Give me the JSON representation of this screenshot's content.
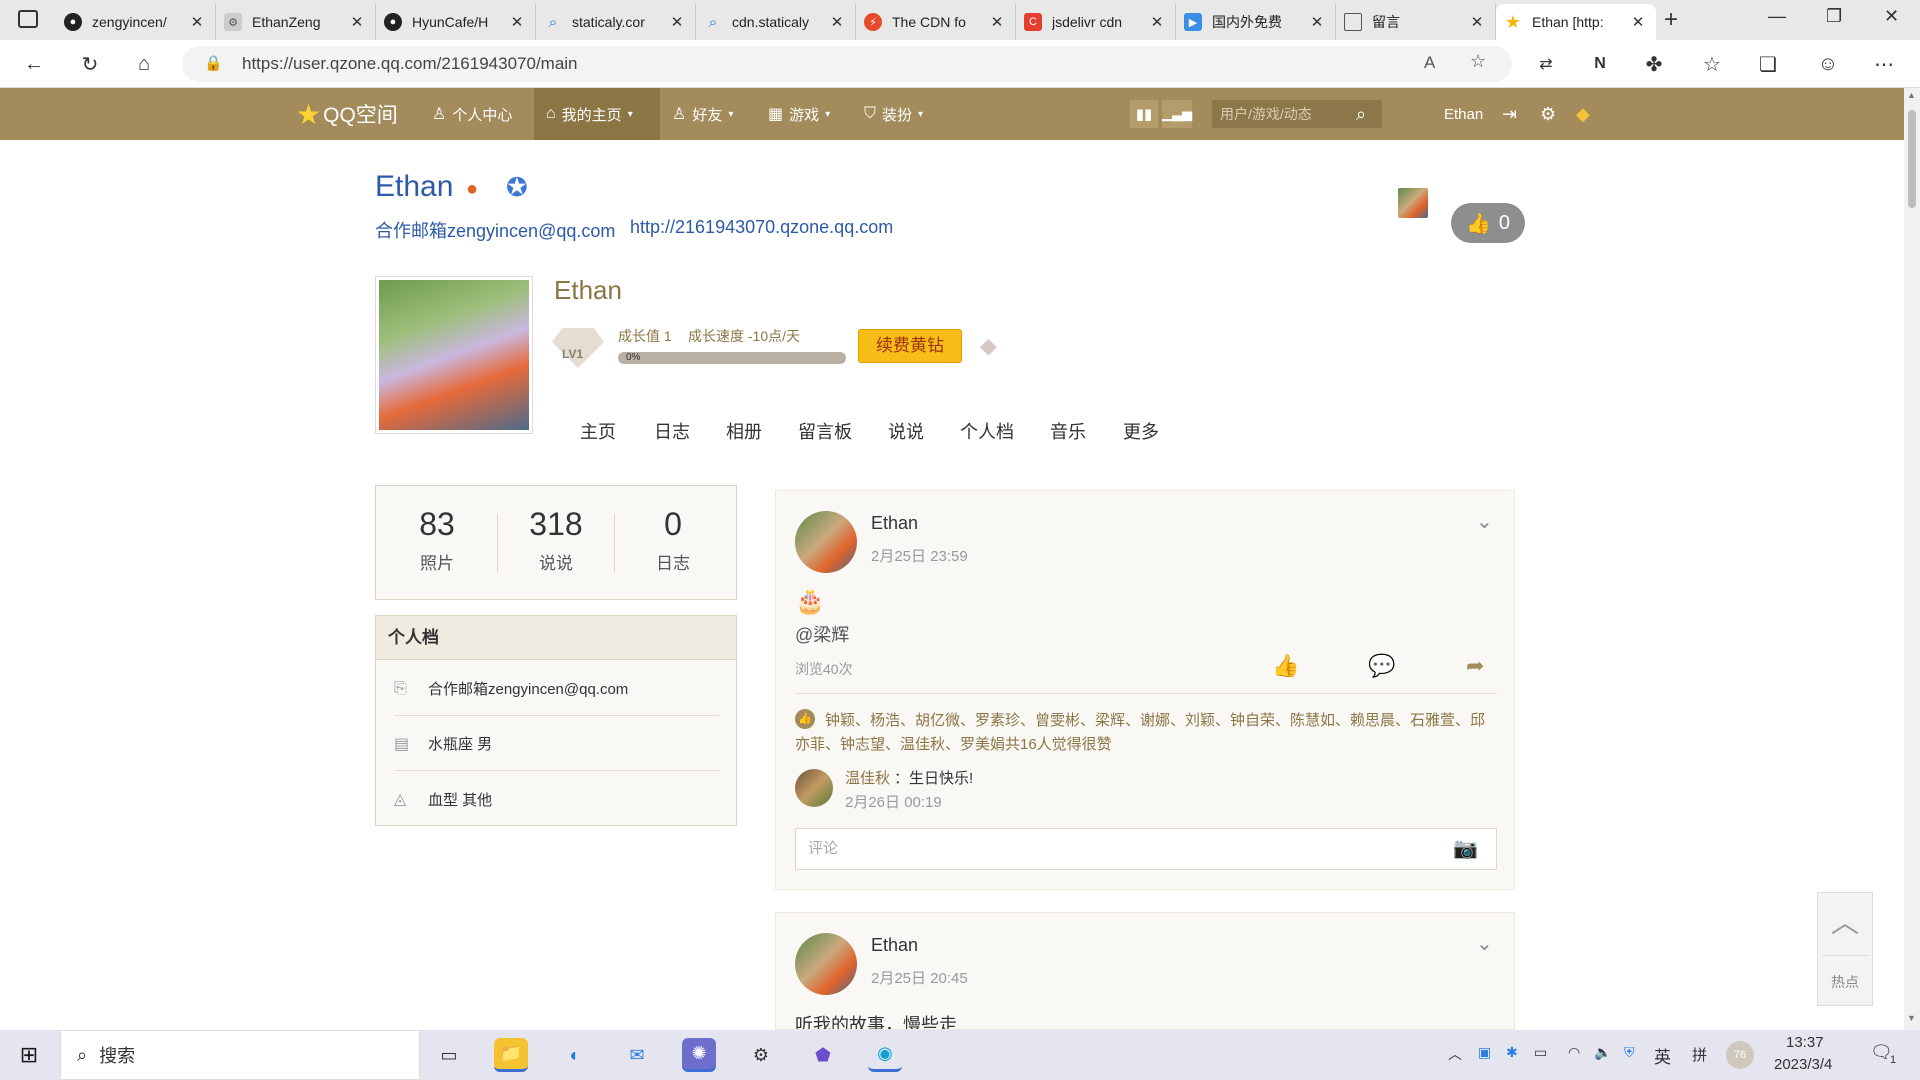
{
  "browser": {
    "tabs": [
      {
        "title": "zengyincen/",
        "icon": "github-icon"
      },
      {
        "title": "EthanZeng",
        "icon": "site-icon"
      },
      {
        "title": "HyunCafe/H",
        "icon": "github-icon"
      },
      {
        "title": "staticaly.cor",
        "icon": "search-icon"
      },
      {
        "title": "cdn.staticaly",
        "icon": "search-icon"
      },
      {
        "title": "The CDN fo",
        "icon": "bolt-icon"
      },
      {
        "title": "jsdelivr cdn",
        "icon": "c-icon"
      },
      {
        "title": "国内外免费",
        "icon": "video-icon"
      },
      {
        "title": "留言",
        "icon": "doc-icon"
      },
      {
        "title": "Ethan [http:",
        "icon": "star-icon"
      }
    ],
    "url": "https://user.qzone.qq.com/2161943070/main"
  },
  "qzone_nav": {
    "logo": "QQ空间",
    "items": [
      "个人中心",
      "我的主页",
      "好友",
      "游戏",
      "装扮"
    ],
    "search_placeholder": "用户/游戏/动态",
    "user": "Ethan"
  },
  "header": {
    "name": "Ethan",
    "contact": "合作邮箱zengyincen@qq.com",
    "site": "http://2161943070.qzone.qq.com",
    "likes": "0"
  },
  "profile": {
    "nickname": "Ethan",
    "level_badge": "LV1",
    "growth_value": "成长值 1",
    "growth_speed": "成长速度 -10点/天",
    "progress_label": "0%",
    "progress": 0,
    "renew_button": "续费黄钻",
    "tabs": [
      "主页",
      "日志",
      "相册",
      "留言板",
      "说说",
      "个人档",
      "音乐",
      "更多"
    ]
  },
  "stats": [
    {
      "num": "83",
      "label": "照片"
    },
    {
      "num": "318",
      "label": "说说"
    },
    {
      "num": "0",
      "label": "日志"
    }
  ],
  "personal": {
    "title": "个人档",
    "rows": [
      "合作邮箱zengyincen@qq.com",
      "水瓶座 男",
      "血型 其他"
    ]
  },
  "posts": [
    {
      "author": "Ethan",
      "time": "2月25日 23:59",
      "emoji": "🎂",
      "text": "@梁辉",
      "views": "浏览40次",
      "likers": "钟颖、杨浩、胡亿微、罗素珍、曾雯彬、梁辉、谢娜、刘颖、钟自荣、陈慧如、赖思晨、石雅萱、邱亦菲、钟志望、温佳秋、罗美娟共16人觉得很赞",
      "comment_author": "温佳秋",
      "comment_text": "：生日快乐!",
      "comment_time": "2月26日 00:19",
      "comment_placeholder": "评论"
    },
    {
      "author": "Ethan",
      "time": "2月25日 20:45",
      "text": "听我的故事，慢些走"
    }
  ],
  "hot": "热点",
  "taskbar": {
    "search": "搜索",
    "ime": "英",
    "ime2": "拼",
    "badge": "76",
    "time": "13:37",
    "date": "2023/3/4",
    "notifications": "1"
  }
}
